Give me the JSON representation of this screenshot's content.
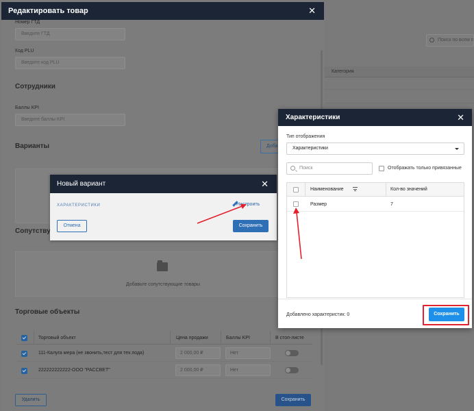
{
  "background": {
    "search_placeholder": "Поиск по всем п",
    "column_category": "Категория"
  },
  "edit_modal": {
    "title": "Редактировать товар",
    "gtd_label": "Номер ГТД",
    "gtd_placeholder": "Введите ГТД",
    "plu_label": "Код PLU",
    "plu_placeholder": "Введите код PLU",
    "employees_title": "Сотрудники",
    "kpi_label": "Баллы KPI",
    "kpi_placeholder": "Введите баллы KPI",
    "variants_title": "Варианты",
    "add_button": "Доба",
    "companion_title": "Сопутству",
    "companion_add_text": "Добавьте сопутствующие товары",
    "trade_objects_title": "Торговые объекты",
    "table": {
      "headers": [
        "Торговый объект",
        "Цена продажи",
        "Баллы KPI",
        "В стоп-листе"
      ],
      "rows": [
        {
          "name": "111-Калуга мера (не звонить,тест для тех.пода)",
          "price": "2 000,00 ₽",
          "kpi": "Нет"
        },
        {
          "name": "222222222222-ООО \"РАССВЕТ\"",
          "price": "2 000,00 ₽",
          "kpi": "Нет"
        }
      ]
    },
    "delete_button": "Удалить",
    "save_button": "Сохранить"
  },
  "variant_modal": {
    "title": "Новый вариант",
    "section_label": "ХАРАКТЕРИСТИКИ",
    "configure_link": "Настроить",
    "cancel_button": "Отмена",
    "save_button": "Сохранить"
  },
  "char_modal": {
    "title": "Характеристики",
    "display_type_label": "Тип отображения",
    "display_type_value": "Характеристики",
    "search_placeholder": "Поиск",
    "only_linked_label": "Отображать только привязанные",
    "columns": {
      "name": "Наименование",
      "count": "Кол-во значений"
    },
    "rows": [
      {
        "name": "Размер",
        "count": "7"
      }
    ],
    "added_text": "Добавлено характеристик: 0",
    "save_button": "Сохранить"
  },
  "colors": {
    "header_dark": "#1c2536",
    "primary_blue": "#1e90ea",
    "highlight_red": "#e3202c"
  }
}
